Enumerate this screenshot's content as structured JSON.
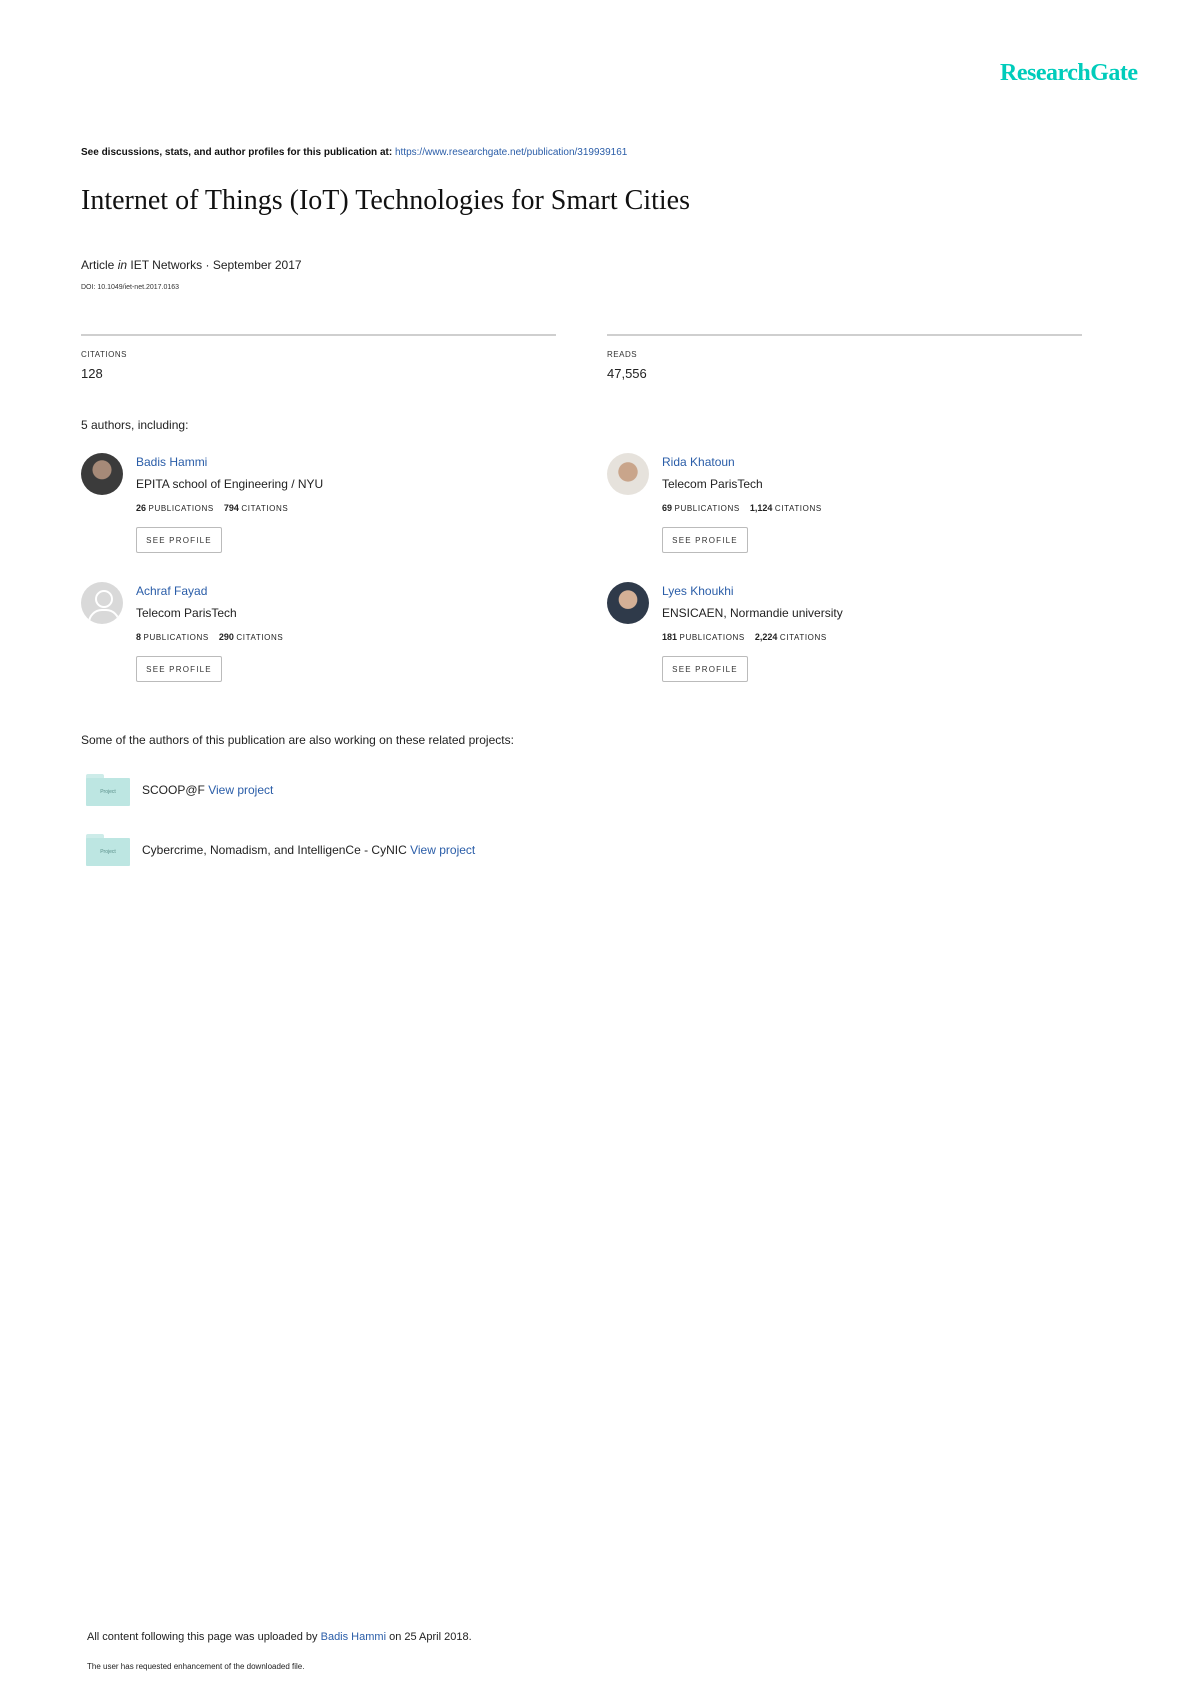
{
  "brand": {
    "logo_text": "ResearchGate",
    "accent_color": "#00ccbb",
    "link_color": "#2a5da8"
  },
  "header": {
    "see_text": "See discussions, stats, and author profiles for this publication at:",
    "url": "https://www.researchgate.net/publication/319939161"
  },
  "publication": {
    "title": "Internet of Things (IoT) Technologies for Smart Cities",
    "type": "Article",
    "in_word": "in",
    "journal": "IET Networks · September 2017",
    "doi": "DOI: 10.1049/iet-net.2017.0163"
  },
  "stats": {
    "citations_label": "CITATIONS",
    "citations_value": "128",
    "reads_label": "READS",
    "reads_value": "47,556"
  },
  "authors_heading": "5 authors, including:",
  "authors": [
    {
      "name": "Badis Hammi",
      "institution": "EPITA school of Engineering / NYU",
      "publications": "26",
      "citations": "794",
      "button": "SEE PROFILE"
    },
    {
      "name": "Rida Khatoun",
      "institution": "Telecom ParisTech",
      "publications": "69",
      "citations": "1,124",
      "button": "SEE PROFILE"
    },
    {
      "name": "Achraf Fayad",
      "institution": "Telecom ParisTech",
      "publications": "8",
      "citations": "290",
      "button": "SEE PROFILE"
    },
    {
      "name": "Lyes Khoukhi",
      "institution": "ENSICAEN, Normandie university",
      "publications": "181",
      "citations": "2,224",
      "button": "SEE PROFILE"
    }
  ],
  "labels": {
    "publications": "PUBLICATIONS",
    "citations": "CITATIONS"
  },
  "projects_heading": "Some of the authors of this publication are also working on these related projects:",
  "projects": [
    {
      "name": "SCOOP@F",
      "link": "View project",
      "folder_label": "Project"
    },
    {
      "name": "Cybercrime, Nomadism, and IntelligenCe - CyNIC",
      "link": "View project",
      "folder_label": "Project"
    }
  ],
  "footer": {
    "prefix": "All content following this page was uploaded by",
    "uploader": "Badis Hammi",
    "suffix": "on 25 April 2018.",
    "note": "The user has requested enhancement of the downloaded file."
  }
}
